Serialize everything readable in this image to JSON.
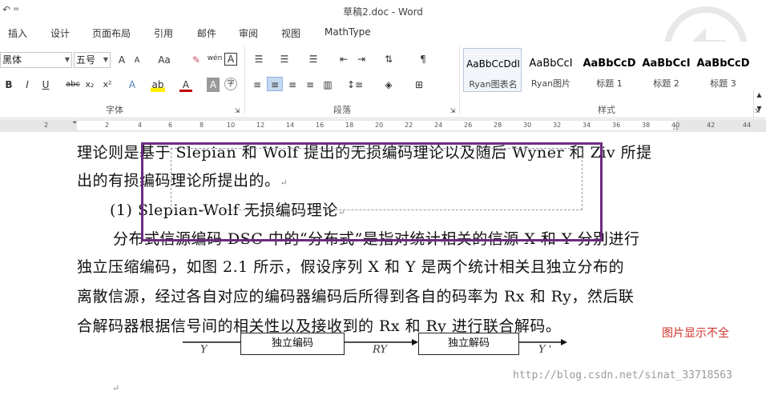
{
  "window": {
    "title": "草稿2.doc - Word",
    "quick_access": "↶",
    "qa_more": "="
  },
  "menu": {
    "items": [
      "插入",
      "设计",
      "页面布局",
      "引用",
      "邮件",
      "审阅",
      "视图",
      "MathType"
    ]
  },
  "font_group": {
    "label": "字体",
    "font_name": "黑体",
    "font_size": "五号",
    "grow": "A",
    "shrink": "A",
    "change_case": "Aa",
    "bold": "B",
    "italic": "I",
    "underline": "U",
    "strike": "abc",
    "subscript": "x₂",
    "superscript": "x²",
    "phonetic": "wén",
    "border_char": "A"
  },
  "paragraph_group": {
    "label": "段落"
  },
  "styles_group": {
    "label": "样式",
    "styles": [
      {
        "sample": "AaBbCcDdI",
        "name": "Ryan图表名"
      },
      {
        "sample": "AaBbCcI",
        "name": "Ryan图片"
      },
      {
        "sample": "AaBbCcD",
        "name": "标题 1"
      },
      {
        "sample": "AaBbCcI",
        "name": "标题 2"
      },
      {
        "sample": "AaBbCcD",
        "name": "标题 3"
      }
    ]
  },
  "ruler": {
    "ticks": [
      "2",
      "2",
      "4",
      "6",
      "8",
      "10",
      "12",
      "14",
      "16",
      "18",
      "20",
      "22",
      "24",
      "26",
      "28",
      "30",
      "32",
      "34",
      "36",
      "38",
      "40",
      "42",
      "44"
    ]
  },
  "document": {
    "line1": "理论则是基于 Slepian 和 Wolf 提出的无损编码理论以及随后 Wyner 和 Ziv 所提",
    "line2": "出的有损编码理论所提出的。",
    "heading": "(1) Slepian-Wolf 无损编码理论",
    "line3": "分布式信源编码 DSC 中的“分布式”是指对统计相关的信源 X 和 Y 分别进行",
    "line4": "独立压缩编码，如图 2.1 所示，假设序列 X 和 Y 是两个统计相关且独立分布的",
    "line5": "离散信源，经过各自对应的编码器编码后所得到各自的码率为 Rx 和 Ry，然后联",
    "line6": "合解码器根据信号间的相关性以及接收到的 Rx 和 Ry 进行联合解码。",
    "para_mark": "↵"
  },
  "figure": {
    "input": "Y",
    "encoder": "独立编码",
    "rate": "RY",
    "decoder": "独立解码",
    "output": "Y '"
  },
  "annotation": {
    "note": "图片显示不全",
    "note_color": "#d0332b",
    "frame_color": "#6b2c80"
  },
  "watermark": "http://blog.csdn.net/sinat_33718563"
}
